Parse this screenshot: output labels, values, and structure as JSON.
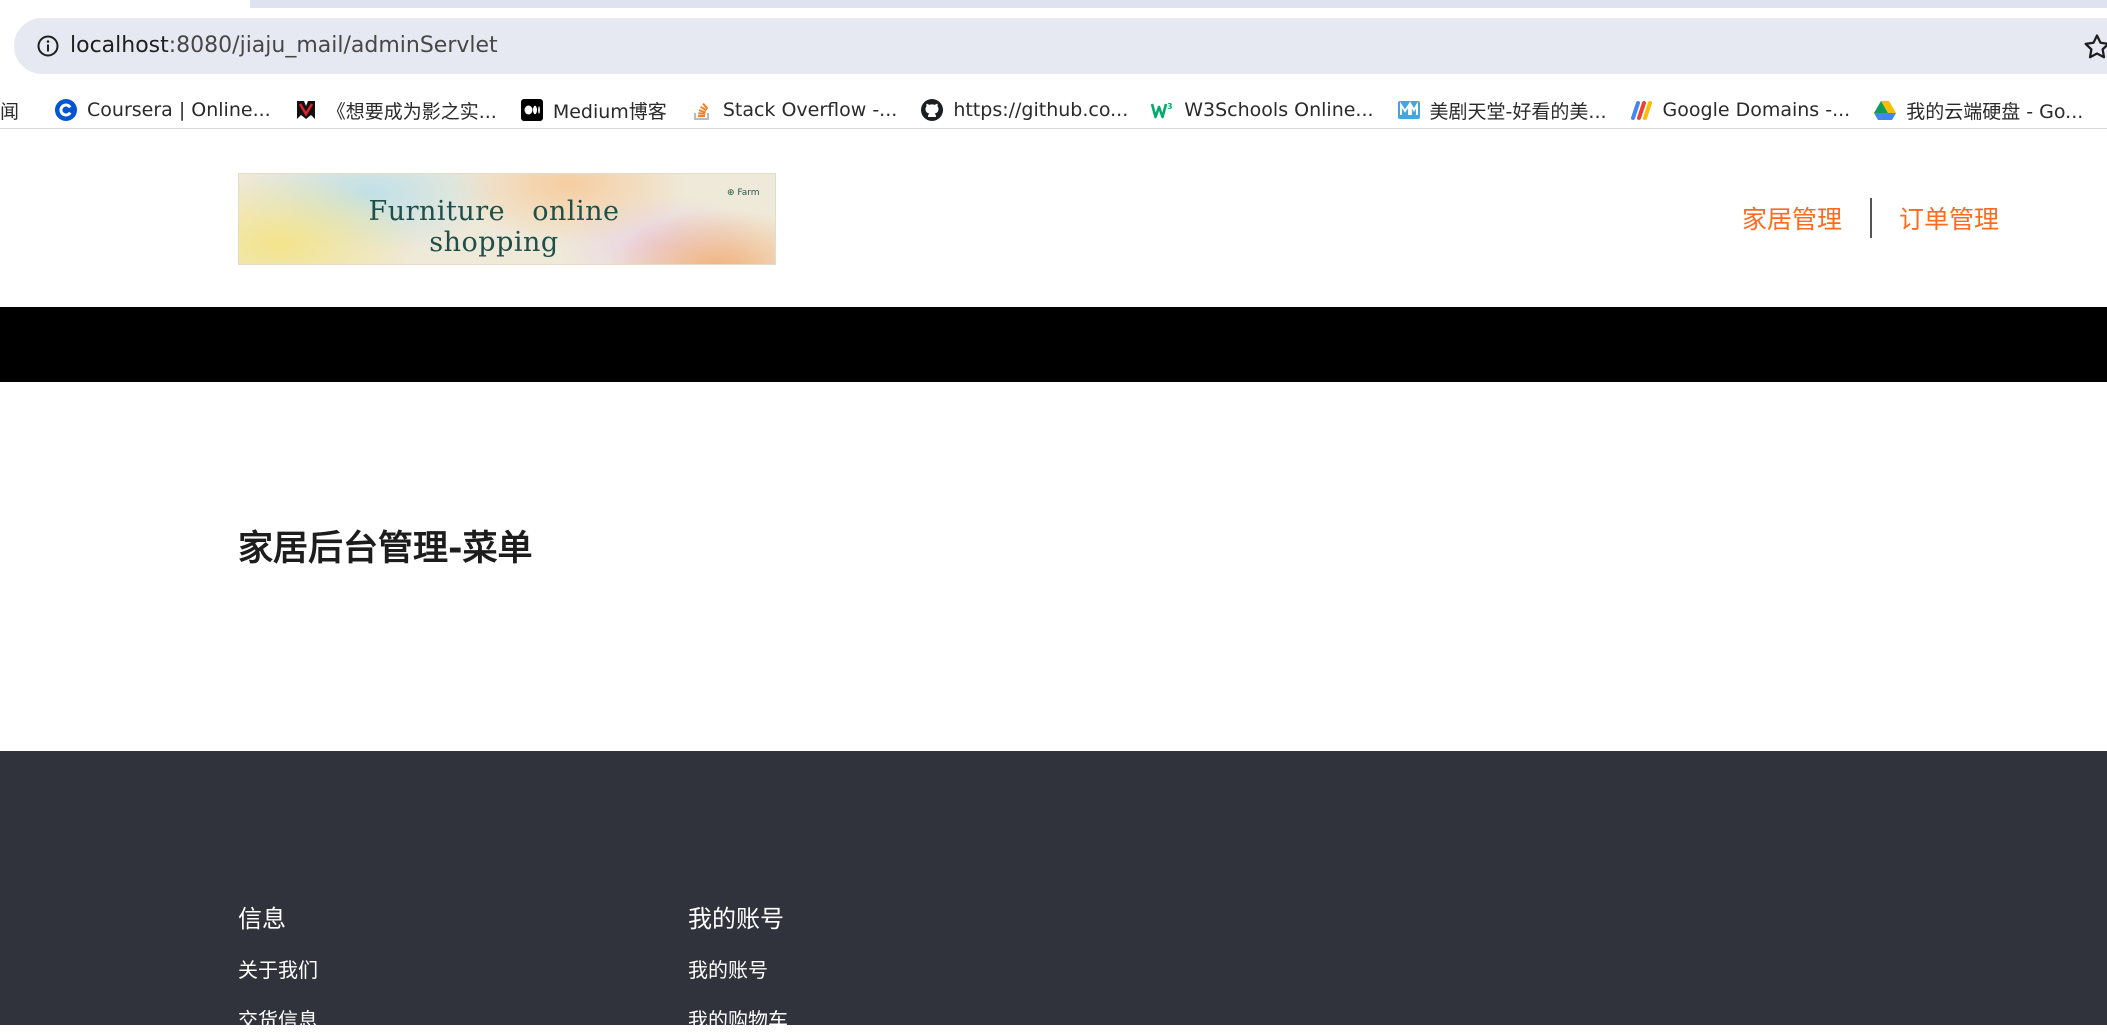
{
  "browser": {
    "url_host": "localhost",
    "url_path": ":8080/jiaju_mail/adminServlet",
    "bookmarks": [
      {
        "label": "闻",
        "icon": "none"
      },
      {
        "label": "Coursera | Online...",
        "icon": "coursera-icon"
      },
      {
        "label": "《想要成为影之实...",
        "icon": "bookmark-red-icon"
      },
      {
        "label": "Medium博客",
        "icon": "medium-icon"
      },
      {
        "label": "Stack Overflow -...",
        "icon": "stackoverflow-icon"
      },
      {
        "label": "https://github.co...",
        "icon": "github-icon"
      },
      {
        "label": "W3Schools Online...",
        "icon": "w3schools-icon"
      },
      {
        "label": "美剧天堂-好看的美...",
        "icon": "meijutt-icon"
      },
      {
        "label": "Google Domains -...",
        "icon": "google-domains-icon"
      },
      {
        "label": "我的云端硬盘 - Go...",
        "icon": "google-drive-icon"
      }
    ]
  },
  "header": {
    "logo_text": "Furniture online shopping",
    "logo_mark": "⊕ Farm",
    "nav": [
      {
        "label": "家居管理"
      },
      {
        "label": "订单管理"
      }
    ]
  },
  "main": {
    "title": "家居后台管理-菜单"
  },
  "footer": {
    "columns": [
      {
        "title": "信息",
        "items": [
          "关于我们",
          "交货信息"
        ]
      },
      {
        "title": "我的账号",
        "items": [
          "我的账号",
          "我的购物车"
        ]
      }
    ]
  },
  "colors": {
    "accent": "#ff6a1f",
    "footer_bg": "#30333b",
    "band": "#000000"
  }
}
